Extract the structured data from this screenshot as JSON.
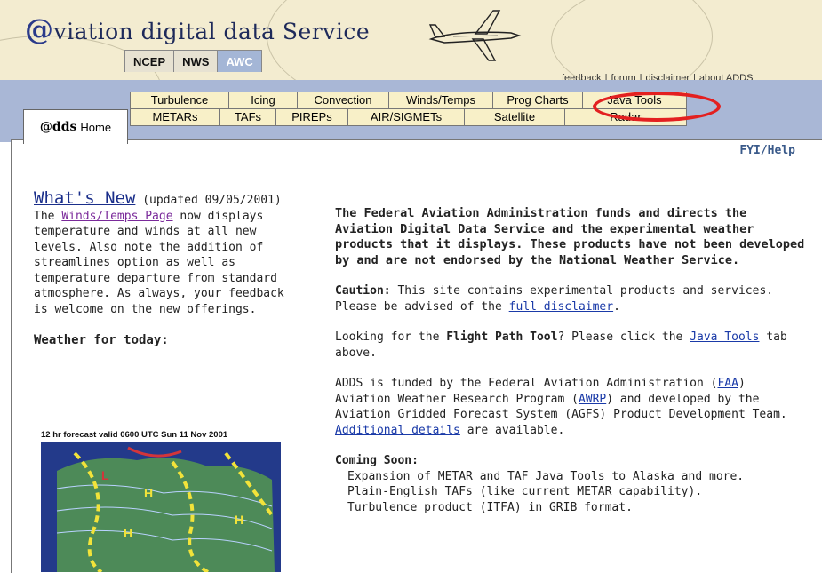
{
  "header": {
    "title_at": "@",
    "title_rest": "viation digital data Service",
    "agency_tabs": [
      {
        "label": "NCEP",
        "active": false
      },
      {
        "label": "NWS",
        "active": false
      },
      {
        "label": "AWC",
        "active": true
      }
    ],
    "top_links": [
      "feedback",
      "forum",
      "disclaimer",
      "about ADDS"
    ],
    "link_separator": "|"
  },
  "tabs": {
    "home_at": "@dds",
    "home_word": "Home",
    "row1": [
      "Turbulence",
      "Icing",
      "Convection",
      "Winds/Temps",
      "Prog Charts",
      "Java Tools"
    ],
    "row2": [
      "METARs",
      "TAFs",
      "PIREPs",
      "AIR/SIGMETs",
      "Satellite",
      "Radar"
    ],
    "highlight_color": "#e32020"
  },
  "fyi_help": "FYI/Help",
  "whats_new": {
    "title": "What's New",
    "updated": "(updated 09/05/2001)",
    "text_before": "The ",
    "link": "Winds/Temps Page",
    "text_after": " now displays temperature and winds at all new levels. Also note the addition of streamlines option as well as temperature departure from standard atmosphere. As always, your feedback is welcome on the new offerings."
  },
  "weather_today": {
    "label": "Weather for today:",
    "map_caption": "12 hr forecast valid 0600 UTC Sun 11 Nov 2001"
  },
  "main": {
    "faa_notice": "The Federal Aviation Administration funds and directs the Aviation Digital Data Service and the experimental weather products that it displays. These products have not been developed by and are not endorsed by the National Weather Service.",
    "caution_label": "Caution:",
    "caution_text": " This site contains experimental products and services. Please be advised of the ",
    "caution_link": "full disclaimer",
    "caution_end": ".",
    "fpt_text1": "Looking for the ",
    "fpt_bold": "Flight Path Tool",
    "fpt_text2": "? Please click the ",
    "fpt_link": "Java Tools",
    "fpt_text3": " tab above.",
    "funding_1": "ADDS is funded by the Federal Aviation Administration (",
    "funding_faa": "FAA",
    "funding_2": ") Aviation Weather Research Program (",
    "funding_awrp": "AWRP",
    "funding_3": ") and developed by the Aviation Gridded Forecast System (AGFS) Product Development Team. ",
    "funding_details": "Additional details",
    "funding_4": " are available.",
    "coming_soon_label": "Coming Soon:",
    "coming_soon_items": [
      "Expansion of METAR and TAF Java Tools to Alaska and more.",
      "Plain-English TAFs (like current METAR capability).",
      "Turbulence product (ITFA) in GRIB format."
    ]
  }
}
